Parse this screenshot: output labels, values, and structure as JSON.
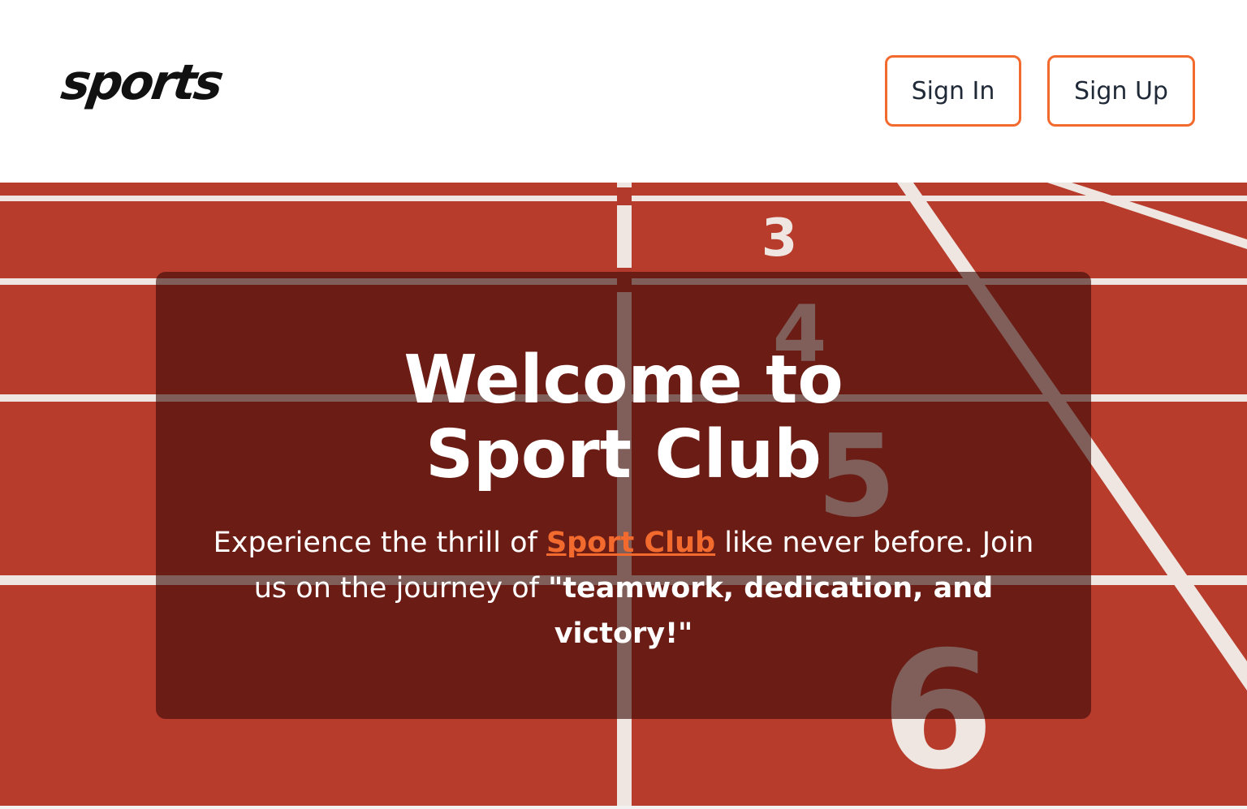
{
  "header": {
    "logo_text": "sports",
    "signin_label": "Sign In",
    "signup_label": "Sign Up"
  },
  "hero": {
    "title": "Welcome to Sport Club",
    "text_before_link": "Experience the thrill of ",
    "link_text": "Sport Club",
    "text_after_link": " like never before. Join us on the journey of ",
    "emphasis": "\"teamwork, dedication, and victory!\"",
    "lane_numbers": [
      "3",
      "4",
      "5",
      "6"
    ]
  },
  "colors": {
    "accent": "#f26a2e",
    "track": "#b23a2c",
    "overlay": "rgba(60,12,8,0.62)"
  }
}
